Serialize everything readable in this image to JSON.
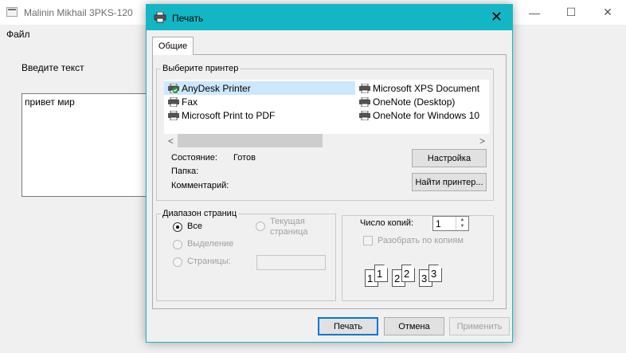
{
  "app": {
    "title": "Malinin Mikhail 3PKS-120",
    "menu_file": "Файл",
    "label": "Введите текст",
    "textarea_value": "привет мир",
    "minimize": "—",
    "maximize": "☐",
    "close": "✕"
  },
  "dialog": {
    "title": "Печать",
    "close": "✕",
    "tab": "Общие",
    "printer_group": "Выберите принтер",
    "printers_col1": [
      "AnyDesk Printer",
      "Fax",
      "Microsoft Print to PDF"
    ],
    "printers_col2": [
      "Microsoft XPS Document",
      "OneNote (Desktop)",
      "OneNote for Windows 10"
    ],
    "selected_printer": "AnyDesk Printer",
    "scroll_left": "<",
    "scroll_right": ">",
    "status_label": "Состояние:",
    "status_value": "Готов",
    "folder_label": "Папка:",
    "comment_label": "Комментарий:",
    "settings_button": "Настройка",
    "find_printer_button": "Найти принтер...",
    "range_group": "Диапазон страниц",
    "range_all": "Все",
    "range_selection": "Выделение",
    "range_current_line1": "Текущая",
    "range_current_line2": "страница",
    "range_pages": "Страницы:",
    "copies_label": "Число копий:",
    "copies_value": "1",
    "collate_label": "Разобрать по копиям",
    "collate_pages": [
      "1",
      "1",
      "2",
      "2",
      "3",
      "3"
    ],
    "print_button": "Печать",
    "cancel_button": "Отмена",
    "apply_button": "Применить"
  },
  "colors": {
    "accent": "#13b6c4",
    "selection": "#cce8ff",
    "default_button_border": "#0078d7"
  }
}
